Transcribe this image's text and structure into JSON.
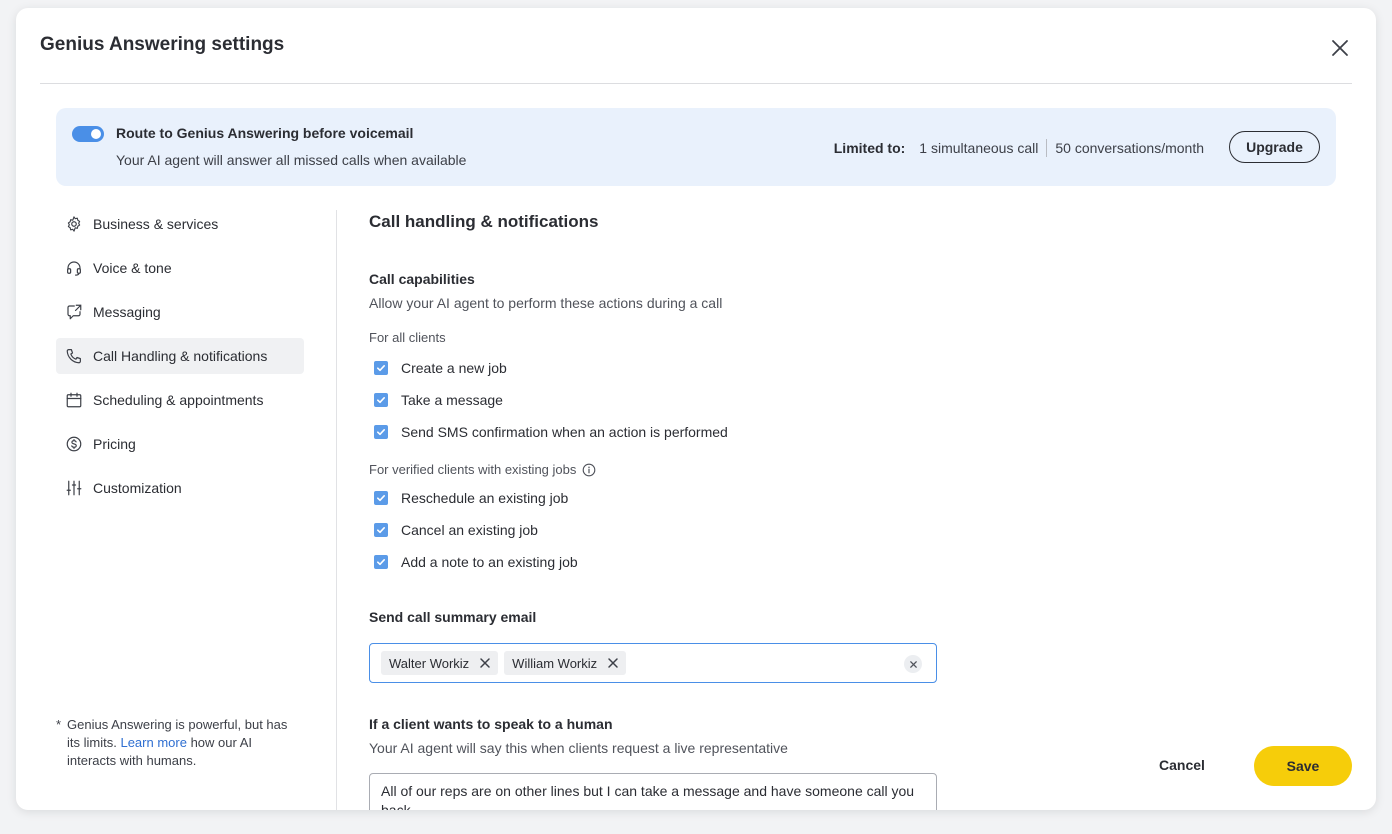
{
  "modal": {
    "title": "Genius Answering settings",
    "close_icon": "close-icon"
  },
  "banner": {
    "title": "Route to Genius Answering before voicemail",
    "subtitle": "Your AI agent will answer all missed calls when available",
    "toggle_on": true,
    "limits_label": "Limited to:",
    "limit_calls": "1 simultaneous call",
    "limit_conversations": "50 conversations/month",
    "upgrade_label": "Upgrade"
  },
  "sidebar": {
    "items": [
      {
        "label": "Business & services",
        "icon": "gear-icon"
      },
      {
        "label": "Voice & tone",
        "icon": "headset-icon"
      },
      {
        "label": "Messaging",
        "icon": "message-share-icon"
      },
      {
        "label": "Call Handling & notifications",
        "icon": "phone-icon",
        "active": true
      },
      {
        "label": "Scheduling & appointments",
        "icon": "calendar-icon"
      },
      {
        "label": "Pricing",
        "icon": "dollar-icon"
      },
      {
        "label": "Customization",
        "icon": "sliders-icon"
      }
    ],
    "footnote": {
      "star": "*",
      "before": "Genius Answering is powerful, but has its limits.",
      "link": "Learn more",
      "after": "how our AI interacts with humans."
    }
  },
  "content": {
    "section_title": "Call handling & notifications",
    "capabilities": {
      "title": "Call capabilities",
      "description": "Allow your AI agent to perform these actions during a call",
      "all_clients_label": "For all clients",
      "all_clients_items": [
        {
          "label": "Create a new job",
          "checked": true
        },
        {
          "label": "Take a message",
          "checked": true
        },
        {
          "label": "Send SMS confirmation when an action is performed",
          "checked": true
        }
      ],
      "verified_label": "For verified clients with existing jobs",
      "verified_items": [
        {
          "label": "Reschedule an existing job",
          "checked": true
        },
        {
          "label": "Cancel an existing job",
          "checked": true
        },
        {
          "label": "Add a note to an existing job",
          "checked": true
        }
      ]
    },
    "summary_email": {
      "title": "Send call summary email",
      "recipients": [
        "Walter Workiz",
        "William Workiz"
      ]
    },
    "human": {
      "title": "If a client wants to speak to a human",
      "description": "Your AI agent will say this when clients request a live representative",
      "message": "All of our reps are on other lines but I can take a message and have someone call you back..."
    }
  },
  "footer": {
    "cancel_label": "Cancel",
    "save_label": "Save"
  },
  "colors": {
    "accent": "#4a8fe7",
    "save": "#f6cd0a",
    "banner_bg": "#e9f1fc",
    "link": "#2f6fd1"
  }
}
